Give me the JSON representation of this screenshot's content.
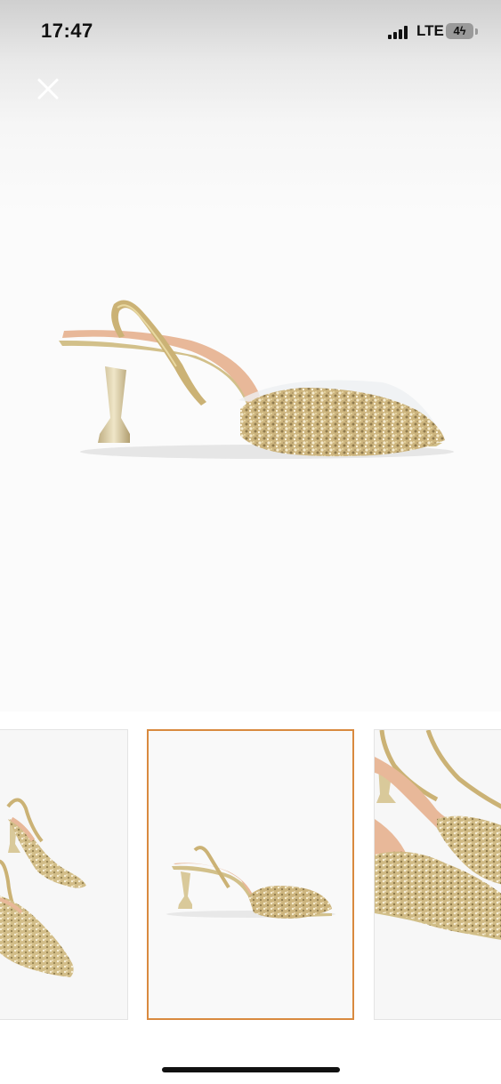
{
  "status_bar": {
    "time": "17:47",
    "network": "LTE",
    "battery": "4ϟ",
    "signal_bars_filled": 4
  },
  "viewer": {
    "close_icon": "close-icon",
    "main_image_alt": "product-image-gold-glitter-slingback-heel"
  },
  "thumbnails": {
    "count_visible": 3,
    "selected_index": 1,
    "selected_border_color": "#d98a3f"
  },
  "colors": {
    "glitter_gold": "#d6c08a",
    "metal_gold": "#cdb98a",
    "lining_nude": "#e9b99a",
    "background": "#fbfbfb"
  }
}
